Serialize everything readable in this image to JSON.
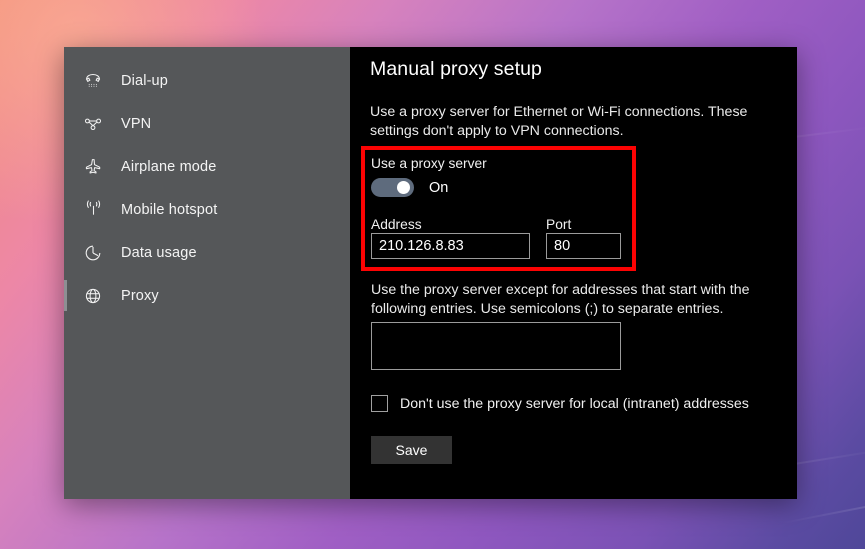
{
  "window": {
    "sidebar": {
      "items": [
        {
          "label": "Dial-up",
          "icon": "dialup-icon",
          "selected": false
        },
        {
          "label": "VPN",
          "icon": "vpn-icon",
          "selected": false
        },
        {
          "label": "Airplane mode",
          "icon": "airplane-icon",
          "selected": false
        },
        {
          "label": "Mobile hotspot",
          "icon": "mobile-hotspot-icon",
          "selected": false
        },
        {
          "label": "Data usage",
          "icon": "data-usage-icon",
          "selected": false
        },
        {
          "label": "Proxy",
          "icon": "globe-icon",
          "selected": true
        }
      ]
    },
    "content": {
      "title": "Manual proxy setup",
      "description": "Use a proxy server for Ethernet or Wi-Fi connections. These settings don't apply to VPN connections.",
      "use_proxy": {
        "label": "Use a proxy server",
        "toggle_state": "On",
        "toggle_on": true
      },
      "address": {
        "label": "Address",
        "value": "210.126.8.83"
      },
      "port": {
        "label": "Port",
        "value": "80"
      },
      "exceptions": {
        "description": "Use the proxy server except for addresses that start with the following entries. Use semicolons (;) to separate entries.",
        "value": ""
      },
      "bypass_local": {
        "label": "Don't use the proxy server for local (intranet) addresses",
        "checked": false
      },
      "save_label": "Save"
    }
  },
  "annotation": {
    "highlight_color": "#fc0303"
  },
  "colors": {
    "sidebar_bg": "#555759",
    "content_bg": "#000000",
    "toggle_on": "#5e6b7d",
    "save_bg": "#333333",
    "selection_bar": "#8d8f93"
  }
}
